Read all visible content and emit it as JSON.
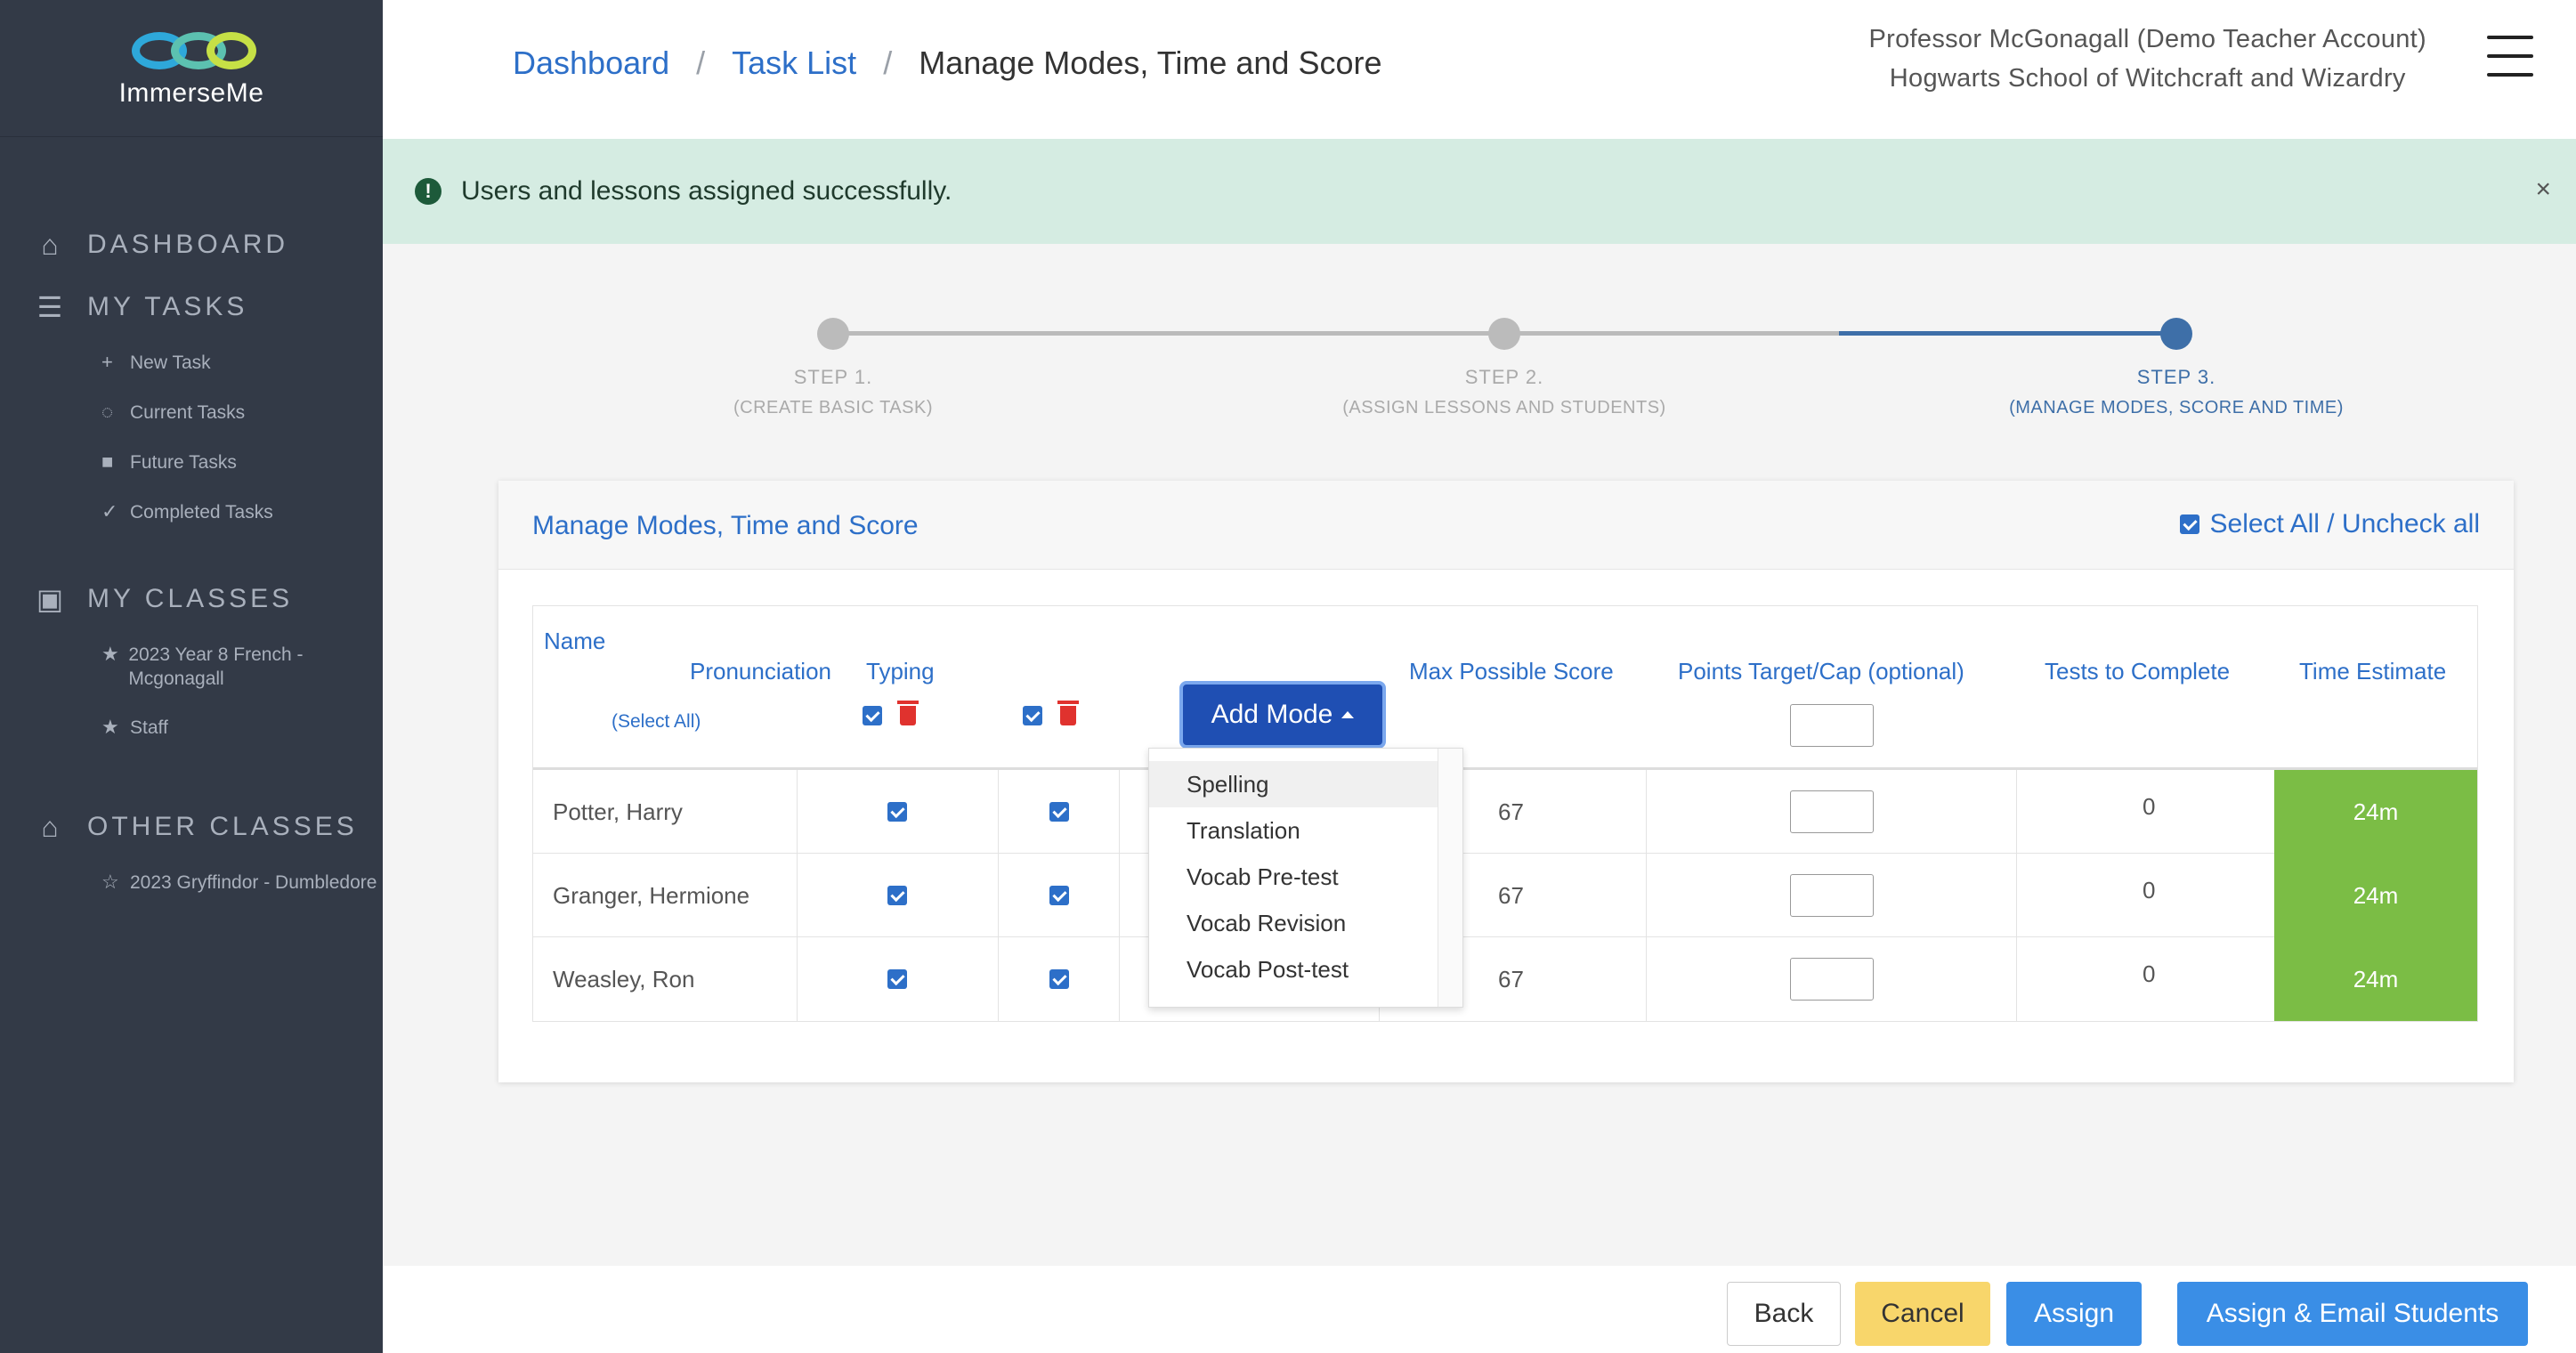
{
  "app": {
    "logo_text": "ImmerseMe"
  },
  "sidebar": {
    "sections": [
      {
        "label": "DASHBOARD",
        "icon": "home-icon"
      },
      {
        "label": "MY TASKS",
        "icon": "list-icon"
      },
      {
        "label": "MY CLASSES",
        "icon": "classroom-icon"
      },
      {
        "label": "OTHER CLASSES",
        "icon": "school-icon"
      }
    ],
    "task_items": [
      {
        "label": "New Task",
        "icon": "plus-icon"
      },
      {
        "label": "Current Tasks",
        "icon": "spinner-icon"
      },
      {
        "label": "Future Tasks",
        "icon": "lock-icon"
      },
      {
        "label": "Completed Tasks",
        "icon": "check-icon"
      }
    ],
    "my_classes": [
      {
        "label": "2023 Year 8 French - Mcgonagall",
        "icon": "star-filled-icon"
      },
      {
        "label": "Staff",
        "icon": "star-filled-icon"
      }
    ],
    "other_classes": [
      {
        "label": "2023 Gryffindor - Dumbledore",
        "icon": "star-outline-icon"
      }
    ]
  },
  "header": {
    "breadcrumb": [
      "Dashboard",
      "Task List",
      "Manage Modes, Time and Score"
    ],
    "separator": "/",
    "user_name": "Professor McGonagall (Demo Teacher Account)",
    "school": "Hogwarts School of Witchcraft and Wizardry"
  },
  "alert": {
    "message": "Users and lessons assigned successfully.",
    "close": "×",
    "icon_glyph": "!"
  },
  "stepper": [
    {
      "title": "STEP 1.",
      "subtitle": "(CREATE BASIC TASK)",
      "active": false
    },
    {
      "title": "STEP 2.",
      "subtitle": "(ASSIGN LESSONS AND STUDENTS)",
      "active": false
    },
    {
      "title": "STEP 3.",
      "subtitle": "(MANAGE MODES, SCORE AND TIME)",
      "active": true
    }
  ],
  "card": {
    "title": "Manage Modes, Time and Score",
    "select_all_label": "Select All / Uncheck all",
    "columns": {
      "name": "Name",
      "select_all": "(Select All)",
      "pronunciation": "Pronunciation",
      "typing": "Typing",
      "add_mode": "Add Mode",
      "max_score": "Max Possible Score",
      "points_target": "Points Target/Cap (optional)",
      "tests": "Tests to Complete",
      "time": "Time Estimate"
    },
    "rows": [
      {
        "name": "Potter, Harry",
        "pronunciation": true,
        "typing": true,
        "max_score": "67",
        "tests": "0",
        "time": "24m"
      },
      {
        "name": "Granger, Hermione",
        "pronunciation": true,
        "typing": true,
        "max_score": "67",
        "tests": "0",
        "time": "24m"
      },
      {
        "name": "Weasley, Ron",
        "pronunciation": true,
        "typing": true,
        "max_score": "67",
        "tests": "0",
        "time": "24m"
      }
    ],
    "add_mode_options": [
      "Spelling",
      "Translation",
      "Vocab Pre-test",
      "Vocab Revision",
      "Vocab Post-test"
    ]
  },
  "footer": {
    "back": "Back",
    "cancel": "Cancel",
    "assign": "Assign",
    "assign_email": "Assign & Email Students"
  },
  "colors": {
    "sidebar_bg": "#333a47",
    "link_blue": "#2d6fc8",
    "alert_bg": "#d5ece2",
    "time_green": "#7bbd45",
    "cancel_yellow": "#f8d66b",
    "primary_blue": "#3a8ee6",
    "add_mode_blue": "#1f4fb3"
  }
}
